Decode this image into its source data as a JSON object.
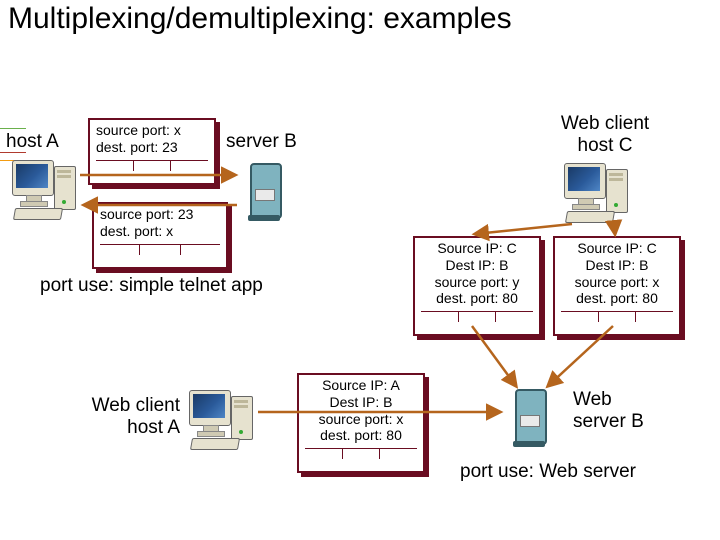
{
  "title": "Multiplexing/demultiplexing: examples",
  "labels": {
    "hostA": "host A",
    "serverB": "server B",
    "hostC": "Web client\nhost C",
    "webA": "Web client\nhost A",
    "webSrvB": "Web\nserver B",
    "telnet": "port use: simple telnet app",
    "webuse": "port use: Web server"
  },
  "seg_top1": {
    "l1": "source port: x",
    "l2": "dest. port: 23"
  },
  "seg_top2": {
    "l1": "source port: 23",
    "l2": "dest. port: x"
  },
  "seg_c1": {
    "l1": "Source IP: C",
    "l2": "Dest IP: B",
    "l3": "source port: y",
    "l4": "dest. port: 80"
  },
  "seg_c2": {
    "l1": "Source IP: C",
    "l2": "Dest IP: B",
    "l3": "source port: x",
    "l4": "dest. port: 80"
  },
  "seg_a": {
    "l1": "Source IP: A",
    "l2": "Dest IP: B",
    "l3": "source port: x",
    "l4": "dest. port: 80"
  }
}
